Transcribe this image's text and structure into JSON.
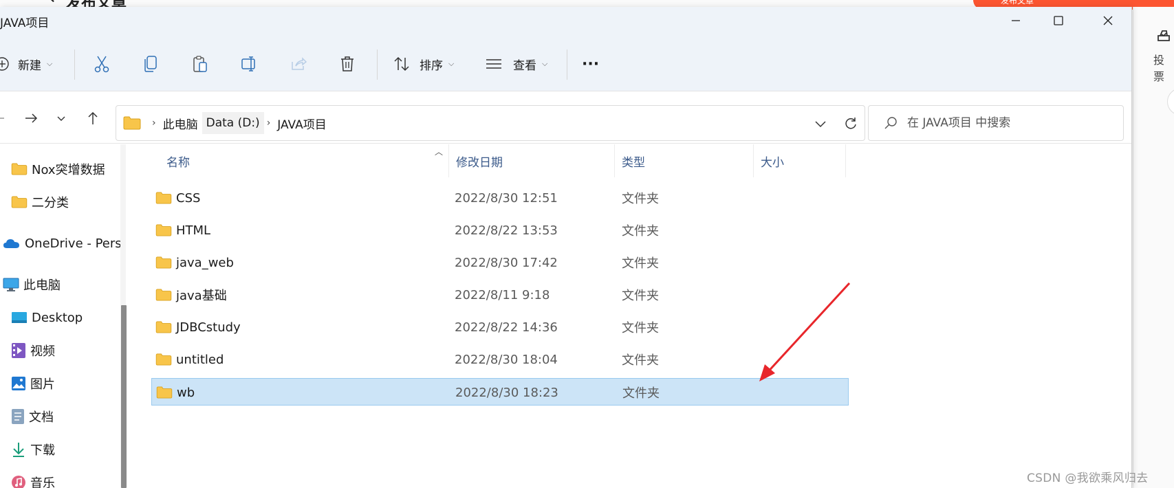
{
  "background": {
    "back_glyph": "←",
    "title": "发布文章",
    "publish_button": "发布文章",
    "vote_label": "投票",
    "watermark": "CSDN @我欲乘风归去"
  },
  "window": {
    "title": "JAVA项目",
    "toolbar": {
      "new_label": "新建",
      "sort_label": "排序",
      "view_label": "查看",
      "more_label": "···"
    },
    "address": {
      "crumbs": [
        "此电脑",
        "Data (D:)",
        "JAVA项目"
      ]
    },
    "search": {
      "placeholder": "在 JAVA项目 中搜索"
    },
    "sidebar": {
      "items": [
        {
          "label": "Nox突增数据",
          "icon": "folder-icon"
        },
        {
          "label": "二分类",
          "icon": "folder-icon"
        },
        {
          "label": "OneDrive - Pers",
          "icon": "cloud-icon"
        },
        {
          "label": "此电脑",
          "icon": "computer-icon"
        },
        {
          "label": "Desktop",
          "icon": "desktop-icon"
        },
        {
          "label": "视频",
          "icon": "video-icon"
        },
        {
          "label": "图片",
          "icon": "pictures-icon"
        },
        {
          "label": "文档",
          "icon": "documents-icon"
        },
        {
          "label": "下载",
          "icon": "download-icon"
        },
        {
          "label": "音乐",
          "icon": "music-icon"
        }
      ]
    },
    "columns": {
      "name": "名称",
      "modified": "修改日期",
      "type": "类型",
      "size": "大小"
    },
    "files": [
      {
        "name": "CSS",
        "modified": "2022/8/30 12:51",
        "type": "文件夹",
        "size": ""
      },
      {
        "name": "HTML",
        "modified": "2022/8/22 13:53",
        "type": "文件夹",
        "size": ""
      },
      {
        "name": "java_web",
        "modified": "2022/8/30 17:42",
        "type": "文件夹",
        "size": ""
      },
      {
        "name": "java基础",
        "modified": "2022/8/11 9:18",
        "type": "文件夹",
        "size": ""
      },
      {
        "name": "JDBCstudy",
        "modified": "2022/8/22 14:36",
        "type": "文件夹",
        "size": ""
      },
      {
        "name": "untitled",
        "modified": "2022/8/30 18:04",
        "type": "文件夹",
        "size": ""
      },
      {
        "name": "wb",
        "modified": "2022/8/30 18:23",
        "type": "文件夹",
        "size": "",
        "selected": true
      }
    ],
    "colors": {
      "selection_bg": "#cce4f7",
      "selection_border": "#99c9ef",
      "annotation_arrow": "#e8262b",
      "folder_yellow": "#f8c54a"
    }
  }
}
